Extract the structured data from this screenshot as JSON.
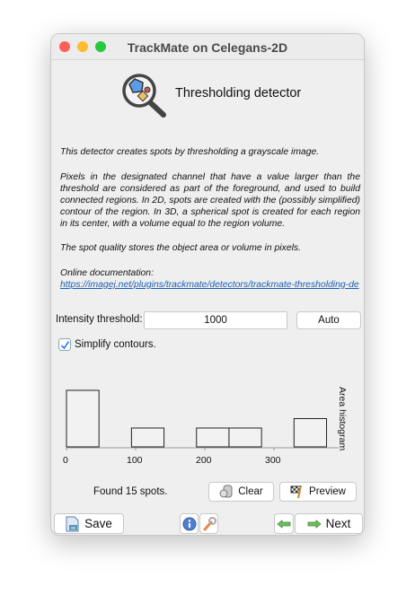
{
  "window": {
    "title": "TrackMate on Celegans-2D"
  },
  "header": {
    "title": "Thresholding detector",
    "icon": "magnifier-detector-icon"
  },
  "description": {
    "p1": "This detector creates spots by thresholding a grayscale image.",
    "p2": "Pixels in the designated channel that have a value larger than the threshold are considered as part of the foreground, and used to build connected regions. In 2D, spots are created with the (possibly simplified) contour of the region. In 3D, a spherical spot is created for each region in its center, with a volume equal to the region volume.",
    "p3": "The spot quality stores the object area or volume in pixels.",
    "doc_label": "Online documentation:",
    "doc_link": "https://imagej.net/plugins/trackmate/detectors/trackmate-thresholding-de"
  },
  "threshold": {
    "label": "Intensity threshold:",
    "value": "1000",
    "auto_label": "Auto"
  },
  "simplify": {
    "label": "Simplify contours.",
    "checked": true
  },
  "chart_data": {
    "type": "bar",
    "title": "Area histogram",
    "xlabel": "",
    "ylabel": "",
    "bin_edges": [
      0,
      47,
      94,
      141,
      188,
      235,
      282,
      329,
      376
    ],
    "values": [
      6,
      0,
      2,
      0,
      2,
      2,
      0,
      3
    ],
    "xticks": [
      "0",
      "100",
      "200",
      "300"
    ],
    "xlim": [
      0,
      400
    ]
  },
  "status": "Found 15 spots.",
  "buttons": {
    "clear": "Clear",
    "preview": "Preview",
    "save": "Save",
    "next": "Next"
  },
  "colors": {
    "link": "#1a5fb4",
    "check": "#3b82f6"
  }
}
